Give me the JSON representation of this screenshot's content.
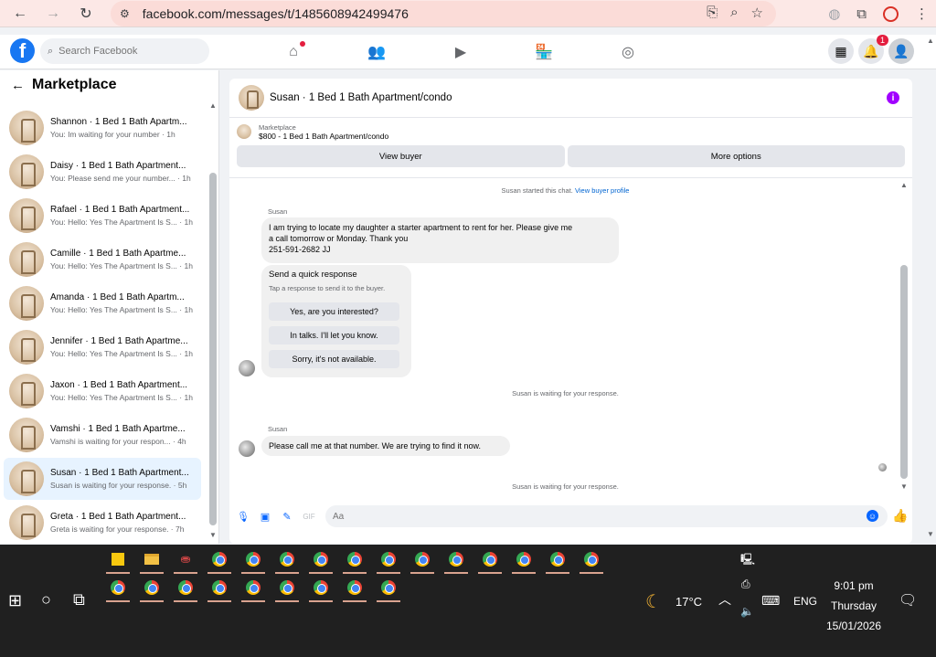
{
  "browser": {
    "url": "facebook.com/messages/t/1485608942499476"
  },
  "fb": {
    "search_placeholder": "Search Facebook",
    "notifications_count": "1"
  },
  "sidebar": {
    "title": "Marketplace",
    "conversations": [
      {
        "name": "Shannon · 1 Bed 1 Bath Apartm...",
        "preview": "You: Im waiting for your number · 1h",
        "active": false
      },
      {
        "name": "Daisy · 1 Bed 1 Bath Apartment...",
        "preview": "You: Please send me your number... · 1h",
        "active": false
      },
      {
        "name": "Rafael · 1 Bed 1 Bath Apartment...",
        "preview": "You: Hello: Yes The Apartment Is S... · 1h",
        "active": false
      },
      {
        "name": "Camille · 1 Bed 1 Bath Apartme...",
        "preview": "You: Hello: Yes The Apartment Is S... · 1h",
        "active": false
      },
      {
        "name": "Amanda · 1 Bed 1 Bath Apartm...",
        "preview": "You: Hello: Yes The Apartment Is S... · 1h",
        "active": false
      },
      {
        "name": "Jennifer · 1 Bed 1 Bath Apartme...",
        "preview": "You: Hello: Yes The Apartment Is S... · 1h",
        "active": false
      },
      {
        "name": "Jaxon · 1 Bed 1 Bath Apartment...",
        "preview": "You: Hello: Yes The Apartment Is S... · 1h",
        "active": false
      },
      {
        "name": "Vamshi · 1 Bed 1 Bath Apartme...",
        "preview": "Vamshi is waiting for your respon... · 4h",
        "active": false
      },
      {
        "name": "Susan · 1 Bed 1 Bath Apartment...",
        "preview": "Susan is waiting for your response. · 5h",
        "active": true
      },
      {
        "name": "Greta · 1 Bed 1 Bath Apartment...",
        "preview": "Greta is waiting for your response. · 7h",
        "active": false
      }
    ]
  },
  "chat": {
    "title": "Susan · 1 Bed 1 Bath Apartment/condo",
    "marketplace_label": "Marketplace",
    "listing": "$800 - 1 Bed 1 Bath Apartment/condo",
    "view_buyer": "View buyer",
    "more_options": "More options",
    "started_text": "Susan started this chat.",
    "view_profile": "View buyer profile",
    "sender": "Susan",
    "message1_lines": [
      "I am trying to locate my daughter a starter apartment to rent for her. Please give me",
      "a call tomorrow or Monday. Thank you",
      "251-591-2682 JJ"
    ],
    "quick_title": "Send a quick response",
    "quick_sub": "Tap a response to send it to the buyer.",
    "quick_options": [
      "Yes, are you interested?",
      "In talks. I'll let you know.",
      "Sorry, it's not available."
    ],
    "waiting": "Susan is waiting for your response.",
    "message2": "Please call me at that number. We are trying to find it now.",
    "input_placeholder": "Aa"
  },
  "taskbar": {
    "weather": "17°C",
    "lang": "ENG",
    "time": "9:01 pm",
    "day": "Thursday",
    "date": "15/01/2026"
  }
}
